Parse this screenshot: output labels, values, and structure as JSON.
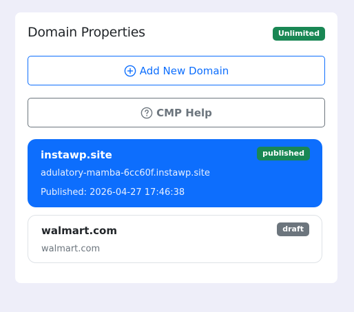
{
  "panel": {
    "title": "Domain Properties",
    "plan_badge": "Unlimited"
  },
  "actions": {
    "add_domain_label": "Add New Domain",
    "add_domain_icon": "plus-circle-icon",
    "help_label": "CMP Help",
    "help_icon": "question-circle-icon"
  },
  "domains": [
    {
      "name": "instawp.site",
      "subdomain": "adulatory-mamba-6cc60f.instawp.site",
      "published_text": "Published: 2026-04-27 17:46:38",
      "status": "published",
      "selected": true
    },
    {
      "name": "walmart.com",
      "subdomain": "walmart.com",
      "status": "draft",
      "selected": false
    }
  ],
  "colors": {
    "primary": "#0d6efd",
    "success": "#198754",
    "secondary": "#6c757d",
    "background": "#eeeef9"
  }
}
